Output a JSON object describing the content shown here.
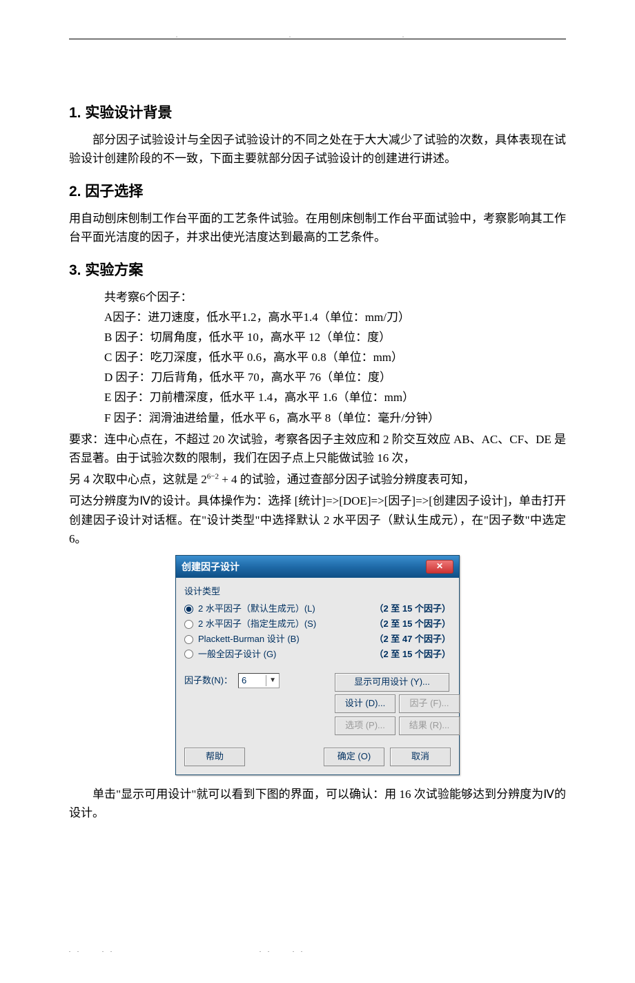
{
  "sections": {
    "s1_title": "1. 实验设计背景",
    "s1_p1": "部分因子试验设计与全因子试验设计的不同之处在于大大减少了试验的次数，具体表现在试验设计创建阶段的不一致，下面主要就部分因子试验设计的创建进行讲述。",
    "s2_title": "2. 因子选择",
    "s2_p1": "用自动刨床刨制工作台平面的工艺条件试验。在用刨床刨制工作台平面试验中，考察影响其工作台平面光洁度的因子，并求出使光洁度达到最高的工艺条件。",
    "s3_title": "3. 实验方案",
    "s3_intro": "共考察6个因子：",
    "factors": {
      "A": "A因子：进刀速度，低水平1.2，高水平1.4（单位：mm/刀）",
      "B": "B 因子：切屑角度，低水平 10，高水平 12（单位：度）",
      "C": "C 因子：吃刀深度，低水平 0.6，高水平 0.8（单位：mm）",
      "D": "D 因子：刀后背角，低水平 70，高水平 76（单位：度）",
      "E": "E 因子：刀前槽深度，低水平 1.4，高水平 1.6（单位：mm）",
      "F": "F 因子：润滑油进给量，低水平 6，高水平 8（单位：毫升/分钟）"
    },
    "s3_req1": "要求：连中心点在，不超过 20 次试验，考察各因子主效应和 2 阶交互效应 AB、AC、CF、DE 是否显著。由于试验次数的限制，我们在因子点上只能做试验 16 次，",
    "s3_req2a": "另 4 次取中心点，这就是 2",
    "s3_req2_exp": "6−2",
    "s3_req2b": " + 4 的试验，通过查部分因子试验分辨度表可知，",
    "s3_req3": "可达分辨度为Ⅳ的设计。具体操作为：选择 [统计]=>[DOE]=>[因子]=>[创建因子设计]，单击打开创建因子设计对话框。在\"设计类型\"中选择默认 2 水平因子（默认生成元），在\"因子数\"中选定 6。",
    "s3_after": "单击\"显示可用设计\"就可以看到下图的界面，可以确认：用 16 次试验能够达到分辨度为Ⅳ的设计。"
  },
  "dialog": {
    "title": "创建因子设计",
    "close": "✕",
    "design_type_label": "设计类型",
    "options": [
      {
        "label": "2 水平因子（默认生成元）(L)",
        "range": "（2 至 15 个因子）",
        "checked": true
      },
      {
        "label": "2 水平因子（指定生成元）(S)",
        "range": "（2 至 15 个因子）",
        "checked": false
      },
      {
        "label": "Plackett-Burman 设计 (B)",
        "range": "（2 至 47 个因子）",
        "checked": false
      },
      {
        "label": "一般全因子设计 (G)",
        "range": "（2 至 15 个因子）",
        "checked": false
      }
    ],
    "factor_count_label": "因子数(N)：",
    "factor_count_value": "6",
    "btn_show": "显示可用设计 (Y)...",
    "btn_design": "设计 (D)...",
    "btn_factor": "因子 (F)...",
    "btn_option": "选项 (P)...",
    "btn_result": "结果 (R)...",
    "btn_help": "帮助",
    "btn_ok": "确定 (O)",
    "btn_cancel": "取消"
  }
}
